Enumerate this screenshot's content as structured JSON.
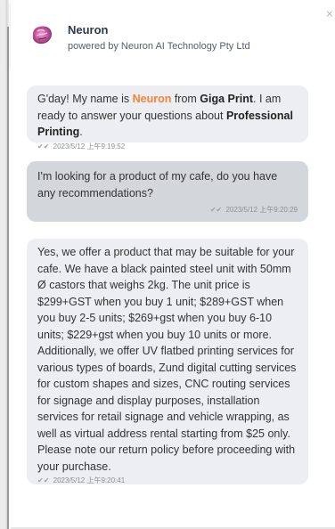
{
  "header": {
    "bot_name": "Neuron",
    "powered_by": "powered by Neuron AI Technology Pty Ltd",
    "close_label": "×"
  },
  "messages": [
    {
      "role": "bot",
      "text_intro": "G'day! My name is ",
      "name": "Neuron",
      "text_from": " from ",
      "company": "Giga Print",
      "text_mid": ". I am ready to answer your questions about ",
      "topic": "Professional Printing",
      "text_end": ".",
      "timestamp": "2023/5/12 上午9:19:52",
      "status_icon": "double-check-icon"
    },
    {
      "role": "user",
      "text": "I'm looking for a product of my cafe, do you have any recommendations?",
      "timestamp": "2023/5/12 上午9:20:29",
      "status_icon": "double-check-icon"
    },
    {
      "role": "bot",
      "text": "Yes, we offer a product that may be suitable for your cafe. We have a black painted steel unit with 50mm Ø castors that weighs 2kg. The unit price is $299+GST when you buy 1 unit; $289+GST when you buy 2-5 units; $269+gst when you buy 6-10 units; $229+gst when you buy 10 units or more. Additionally, we offer UV flatbed printing services for various types of boards, Zund digital cutting services for custom shapes and sizes, CNC routing services for signage and display purposes, installation services for retail signage and vehicle wrapping, as well as virtual address rental starting from $25 only. Please note our return policy before proceeding with your purchase.",
      "timestamp": "2023/5/12 上午9:20:41",
      "status_icon": "double-check-icon"
    }
  ],
  "colors": {
    "accent": "#f5823a",
    "bot_bubble": "#eceef1",
    "user_bubble": "#d3d7dc"
  },
  "check_glyph": "✔✔"
}
